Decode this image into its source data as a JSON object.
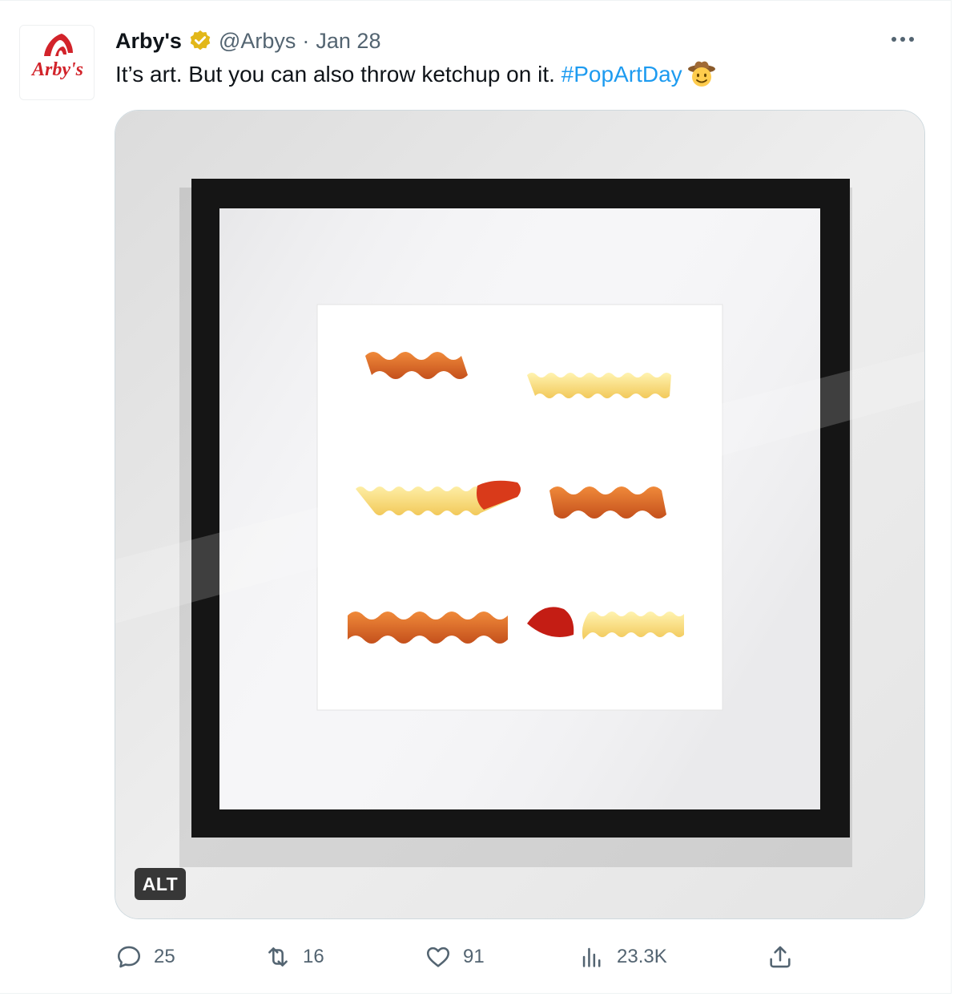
{
  "tweet": {
    "display_name": "Arby's",
    "handle": "@Arbys",
    "separator": "·",
    "date": "Jan 28",
    "text_main": "It’s art. But you can also throw ketchup on it. ",
    "hashtag": "#PopArtDay",
    "emoji": "cowboy-hat-face",
    "avatar_logo_text": "Arby's",
    "brand_color": "#d2232a",
    "link_color": "#1d9bf0",
    "verified_color": "#e2b719"
  },
  "media": {
    "alt_label": "ALT",
    "description": "framed picture of six fries"
  },
  "actions": {
    "replies": "25",
    "reposts": "16",
    "likes": "91",
    "views": "23.3K"
  }
}
